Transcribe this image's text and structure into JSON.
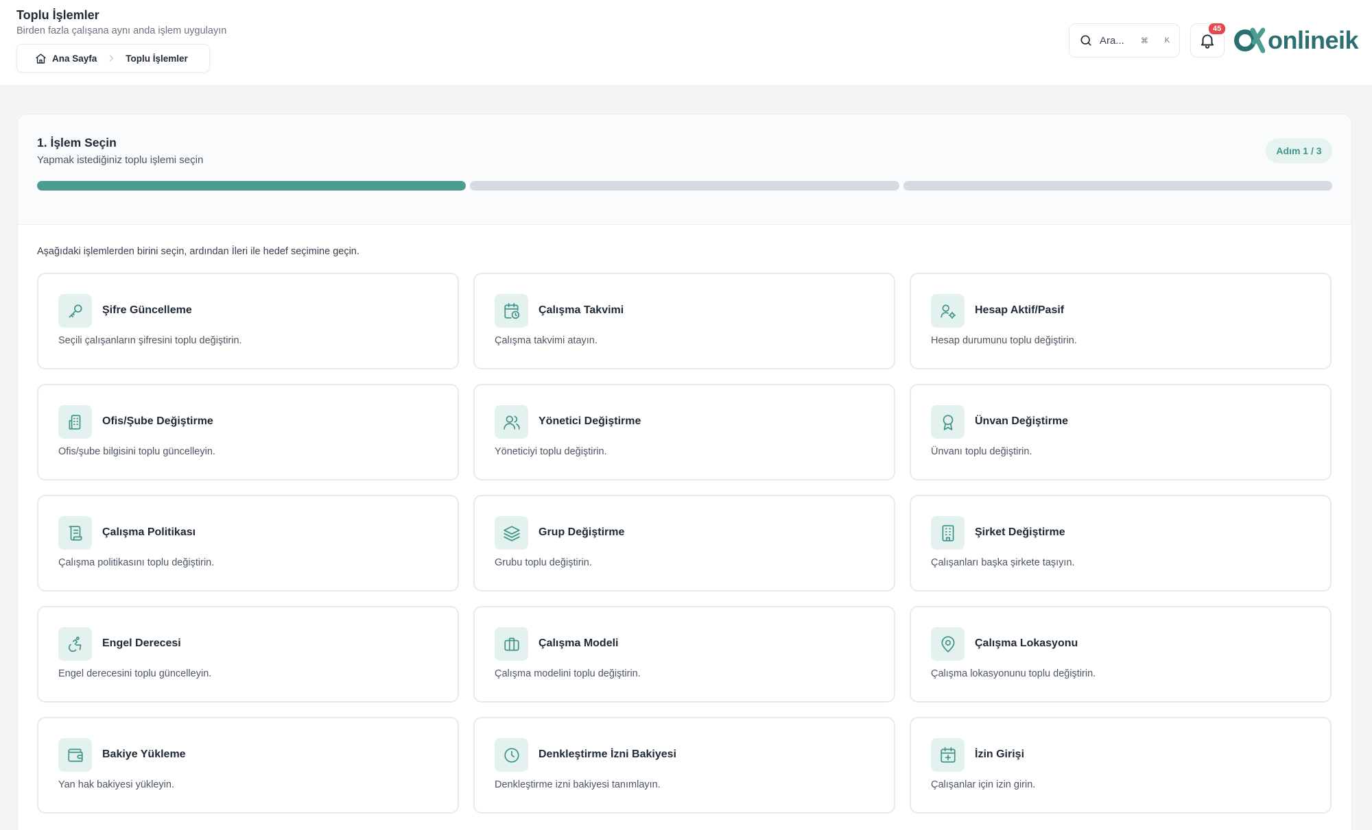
{
  "header": {
    "title": "Toplu İşlemler",
    "subtitle": "Birden fazla çalışana aynı anda işlem uygulayın",
    "breadcrumb": {
      "home": "Ana Sayfa",
      "current": "Toplu İşlemler"
    },
    "search": {
      "placeholder": "Ara...",
      "shortcut_mod": "⌘",
      "shortcut_key": "K"
    },
    "notifications": {
      "count": "45"
    },
    "logo": {
      "text": "onlineik"
    }
  },
  "step": {
    "title": "1. İşlem Seçin",
    "subtitle": "Yapmak istediğiniz toplu işlemi seçin",
    "badge": "Adım 1 / 3",
    "progress": {
      "current": 1,
      "total": 3
    }
  },
  "instructions": "Aşağıdaki işlemlerden birini seçin, ardından İleri ile hedef seçimine geçin.",
  "operations": [
    {
      "icon": "key-icon",
      "title": "Şifre Güncelleme",
      "desc": "Seçili çalışanların şifresini toplu değiştirin."
    },
    {
      "icon": "calendar-clock-icon",
      "title": "Çalışma Takvimi",
      "desc": "Çalışma takvimi atayın."
    },
    {
      "icon": "user-cog-icon",
      "title": "Hesap Aktif/Pasif",
      "desc": "Hesap durumunu toplu değiştirin."
    },
    {
      "icon": "building-icon",
      "title": "Ofis/Şube Değiştirme",
      "desc": "Ofis/şube bilgisini toplu güncelleyin."
    },
    {
      "icon": "users-icon",
      "title": "Yönetici Değiştirme",
      "desc": "Yöneticiyi toplu değiştirin."
    },
    {
      "icon": "award-icon",
      "title": "Ünvan Değiştirme",
      "desc": "Ünvanı toplu değiştirin."
    },
    {
      "icon": "scroll-icon",
      "title": "Çalışma Politikası",
      "desc": "Çalışma politikasını toplu değiştirin."
    },
    {
      "icon": "layers-icon",
      "title": "Grup Değiştirme",
      "desc": "Grubu toplu değiştirin."
    },
    {
      "icon": "office-building-icon",
      "title": "Şirket Değiştirme",
      "desc": "Çalışanları başka şirkete taşıyın."
    },
    {
      "icon": "accessibility-icon",
      "title": "Engel Derecesi",
      "desc": "Engel derecesini toplu güncelleyin."
    },
    {
      "icon": "briefcase-icon",
      "title": "Çalışma Modeli",
      "desc": "Çalışma modelini toplu değiştirin."
    },
    {
      "icon": "map-pin-icon",
      "title": "Çalışma Lokasyonu",
      "desc": "Çalışma lokasyonunu toplu değiştirin."
    },
    {
      "icon": "wallet-icon",
      "title": "Bakiye Yükleme",
      "desc": "Yan hak bakiyesi yükleyin."
    },
    {
      "icon": "clock-icon",
      "title": "Denkleştirme İzni Bakiyesi",
      "desc": "Denkleştirme izni bakiyesi tanımlayın."
    },
    {
      "icon": "calendar-plus-icon",
      "title": "İzin Girişi",
      "desc": "Çalışanlar için izin girin."
    }
  ],
  "colors": {
    "accent": "#4a9e91",
    "accent_light": "#e4f2ef",
    "badge_red": "#e5484d",
    "logo": "#2b6f70"
  }
}
